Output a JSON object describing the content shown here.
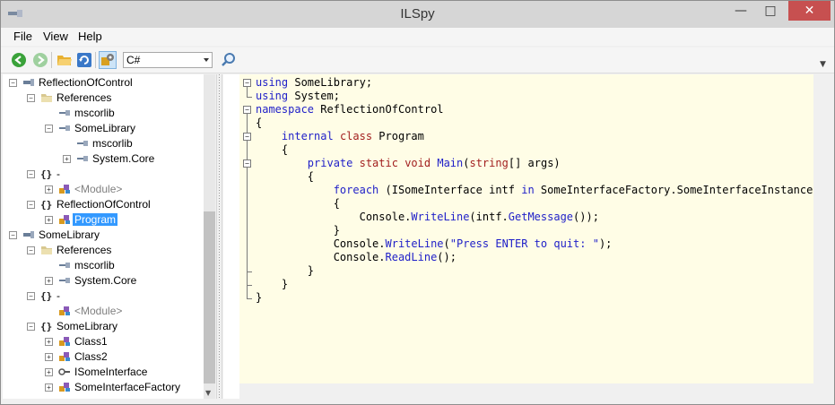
{
  "window": {
    "title": "ILSpy",
    "buttons": {
      "minimize": "—",
      "maximize": "□",
      "close": "✕"
    }
  },
  "menu": {
    "file": "File",
    "view": "View",
    "help": "Help"
  },
  "toolbar": {
    "language": "C#",
    "icons": [
      "back-icon",
      "forward-icon",
      "open-icon",
      "refresh-icon",
      "show-internals-icon",
      "search-icon"
    ]
  },
  "tree": {
    "nodes": [
      {
        "label": "ReflectionOfControl",
        "icon": "assembly-icon",
        "state": "collapse"
      },
      {
        "label": "References",
        "icon": "folder-icon",
        "state": "collapse"
      },
      {
        "label": "mscorlib",
        "icon": "assembly-ref-icon",
        "state": "none"
      },
      {
        "label": "SomeLibrary",
        "icon": "assembly-ref-icon",
        "state": "collapse"
      },
      {
        "label": "mscorlib",
        "icon": "assembly-ref-icon",
        "state": "none"
      },
      {
        "label": "System.Core",
        "icon": "assembly-ref-icon",
        "state": "expand"
      },
      {
        "label": "-",
        "icon": "namespace-icon",
        "state": "collapse"
      },
      {
        "label": "<Module>",
        "icon": "class-icon",
        "state": "expand"
      },
      {
        "label": "ReflectionOfControl",
        "icon": "namespace-icon",
        "state": "collapse"
      },
      {
        "label": "Program",
        "icon": "class-icon",
        "state": "expand"
      },
      {
        "label": "SomeLibrary",
        "icon": "assembly-icon",
        "state": "collapse"
      },
      {
        "label": "References",
        "icon": "folder-icon",
        "state": "collapse"
      },
      {
        "label": "mscorlib",
        "icon": "assembly-ref-icon",
        "state": "none"
      },
      {
        "label": "System.Core",
        "icon": "assembly-ref-icon",
        "state": "expand"
      },
      {
        "label": "-",
        "icon": "namespace-icon",
        "state": "collapse"
      },
      {
        "label": "<Module>",
        "icon": "class-icon",
        "state": "none"
      },
      {
        "label": "SomeLibrary",
        "icon": "namespace-icon",
        "state": "collapse"
      },
      {
        "label": "Class1",
        "icon": "class-icon",
        "state": "expand"
      },
      {
        "label": "Class2",
        "icon": "class-icon",
        "state": "expand"
      },
      {
        "label": "ISomeInterface",
        "icon": "interface-icon",
        "state": "expand"
      },
      {
        "label": "SomeInterfaceFactory",
        "icon": "class-icon",
        "state": "expand"
      }
    ],
    "selected": "Program"
  },
  "code": {
    "lines": [
      [
        {
          "t": "using",
          "c": "kw"
        },
        {
          "t": " SomeLibrary;"
        }
      ],
      [
        {
          "t": "using",
          "c": "kw"
        },
        {
          "t": " System;"
        }
      ],
      [
        {
          "t": "namespace",
          "c": "kw"
        },
        {
          "t": " ReflectionOfControl"
        }
      ],
      [
        {
          "t": "{"
        }
      ],
      [
        {
          "t": "    "
        },
        {
          "t": "internal",
          "c": "kw"
        },
        {
          "t": " "
        },
        {
          "t": "class",
          "c": "kw2"
        },
        {
          "t": " Program"
        }
      ],
      [
        {
          "t": "    {"
        }
      ],
      [
        {
          "t": "        "
        },
        {
          "t": "private",
          "c": "kw"
        },
        {
          "t": " "
        },
        {
          "t": "static",
          "c": "kw2"
        },
        {
          "t": " "
        },
        {
          "t": "void",
          "c": "kw2"
        },
        {
          "t": " "
        },
        {
          "t": "Main",
          "c": "kw"
        },
        {
          "t": "("
        },
        {
          "t": "string",
          "c": "kw2"
        },
        {
          "t": "[] args)"
        }
      ],
      [
        {
          "t": "        {"
        }
      ],
      [
        {
          "t": "            "
        },
        {
          "t": "foreach",
          "c": "kw"
        },
        {
          "t": " (ISomeInterface intf "
        },
        {
          "t": "in",
          "c": "kw"
        },
        {
          "t": " SomeInterfaceFactory.SomeInterfaceInstances)"
        }
      ],
      [
        {
          "t": "            {"
        }
      ],
      [
        {
          "t": "                Console."
        },
        {
          "t": "WriteLine",
          "c": "kw"
        },
        {
          "t": "(intf."
        },
        {
          "t": "GetMessage",
          "c": "kw"
        },
        {
          "t": "());"
        }
      ],
      [
        {
          "t": "            }"
        }
      ],
      [
        {
          "t": "            Console."
        },
        {
          "t": "WriteLine",
          "c": "kw"
        },
        {
          "t": "("
        },
        {
          "t": "\"Press ENTER to quit: \"",
          "c": "str"
        },
        {
          "t": ");"
        }
      ],
      [
        {
          "t": "            Console."
        },
        {
          "t": "ReadLine",
          "c": "kw"
        },
        {
          "t": "();"
        }
      ],
      [
        {
          "t": "        }"
        }
      ],
      [
        {
          "t": "    }"
        }
      ],
      [
        {
          "t": "}"
        }
      ]
    ]
  }
}
